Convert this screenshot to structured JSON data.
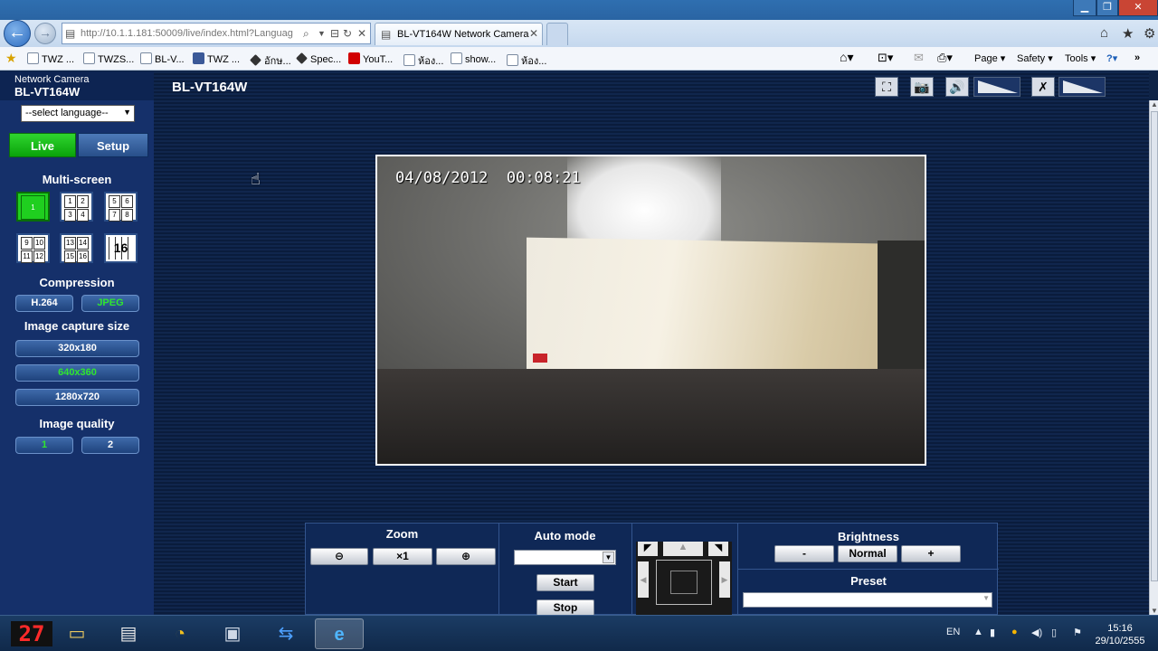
{
  "browser": {
    "address": "http://10.1.1.181:50009/live/index.html?Languag",
    "address_host": "10.1.1.181",
    "tab_title": "BL-VT164W Network Camera",
    "favorites": [
      "TWZ ...",
      "TWZS...",
      "BL-V...",
      "TWZ ...",
      "อักษ...",
      "Spec...",
      "YouT...",
      "ห้อง...",
      "show...",
      "ห้อง..."
    ],
    "commands": {
      "page": "Page",
      "safety": "Safety",
      "tools": "Tools"
    }
  },
  "camera": {
    "brand_small": "Network Camera",
    "brand_model": "BL-VT164W",
    "page_title": "BL-VT164W",
    "language_placeholder": "--select language--",
    "live_label": "Live",
    "setup_label": "Setup",
    "multiscreen_title": "Multi-screen",
    "multiscreen_buttons": [
      [
        "1"
      ],
      [
        "1",
        "2",
        "3",
        "4"
      ],
      [
        "5",
        "6",
        "7",
        "8"
      ],
      [
        "9",
        "10",
        "11",
        "12"
      ],
      [
        "13",
        "14",
        "15",
        "16"
      ],
      [
        "16"
      ]
    ],
    "compression_title": "Compression",
    "compression_options": [
      "H.264",
      "JPEG"
    ],
    "compression_selected": "JPEG",
    "capture_title": "Image capture size",
    "capture_sizes": [
      "320x180",
      "640x360",
      "1280x720"
    ],
    "capture_selected": "640x360",
    "quality_title": "Image quality",
    "quality_options": [
      "1",
      "2"
    ],
    "quality_selected": "1",
    "osd_date": "04/08/2012",
    "osd_time": "00:08:21",
    "zoom_title": "Zoom",
    "zoom_x1": "×1",
    "auto_title": "Auto mode",
    "start_label": "Start",
    "stop_label": "Stop",
    "brightness_title": "Brightness",
    "brightness_minus": "-",
    "brightness_normal": "Normal",
    "brightness_plus": "+",
    "preset_title": "Preset"
  },
  "taskbar": {
    "counter": "27",
    "lang": "EN",
    "time": "15:16",
    "date": "29/10/2555"
  },
  "colors": {
    "live_green": "#1fcf1f",
    "selected_text": "#2fe62f",
    "page_bg": "#10264d"
  }
}
